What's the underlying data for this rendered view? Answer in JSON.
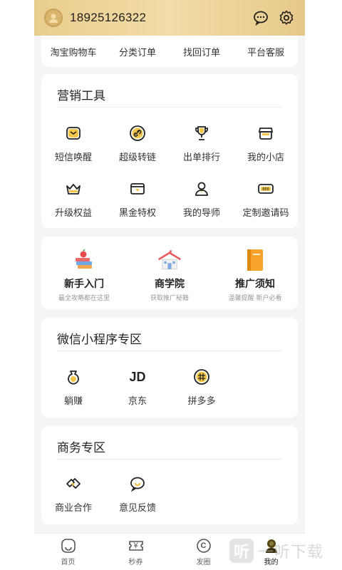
{
  "header": {
    "phone": "18925126322",
    "chat_icon": "chat-icon",
    "settings_icon": "gear-icon"
  },
  "orders": [
    "淘宝购物车",
    "分类订单",
    "找回订单",
    "平台客服"
  ],
  "marketing": {
    "title": "营销工具",
    "items": [
      {
        "label": "短信唤醒",
        "icon": "sms-icon"
      },
      {
        "label": "超级转链",
        "icon": "link-icon"
      },
      {
        "label": "出单排行",
        "icon": "trophy-icon"
      },
      {
        "label": "我的小店",
        "icon": "shop-icon"
      },
      {
        "label": "升级权益",
        "icon": "crown-icon"
      },
      {
        "label": "黑金特权",
        "icon": "card-icon"
      },
      {
        "label": "我的导师",
        "icon": "mentor-icon"
      },
      {
        "label": "定制邀请码",
        "icon": "code-icon"
      }
    ]
  },
  "guides": [
    {
      "title": "新手入门",
      "sub": "最全攻略都在这里",
      "icon": "books-icon"
    },
    {
      "title": "商学院",
      "sub": "获取推广秘籍",
      "icon": "school-icon"
    },
    {
      "title": "推广须知",
      "sub": "温馨提醒·新户必看",
      "icon": "notebook-icon"
    }
  ],
  "wechat": {
    "title": "微信小程序专区",
    "items": [
      {
        "label": "躺赚",
        "icon": "money-bag-icon"
      },
      {
        "label": "京东",
        "icon": "jd-icon",
        "glyph": "JD"
      },
      {
        "label": "拼多多",
        "icon": "pdd-icon"
      }
    ]
  },
  "business": {
    "title": "商务专区",
    "items": [
      {
        "label": "商业合作",
        "icon": "handshake-icon"
      },
      {
        "label": "意见反馈",
        "icon": "feedback-icon"
      }
    ]
  },
  "tabs": [
    {
      "label": "首页",
      "icon": "home-icon"
    },
    {
      "label": "秒券",
      "icon": "coupon-icon",
      "glyph": "¥"
    },
    {
      "label": "发圈",
      "icon": "share-icon",
      "glyph": "C"
    },
    {
      "label": "我的",
      "icon": "profile-icon",
      "active": true
    }
  ],
  "watermark": {
    "glyph": "听",
    "text": "一听下载"
  },
  "colors": {
    "accent": "#f0b92a",
    "header_gold": "#eed297"
  }
}
